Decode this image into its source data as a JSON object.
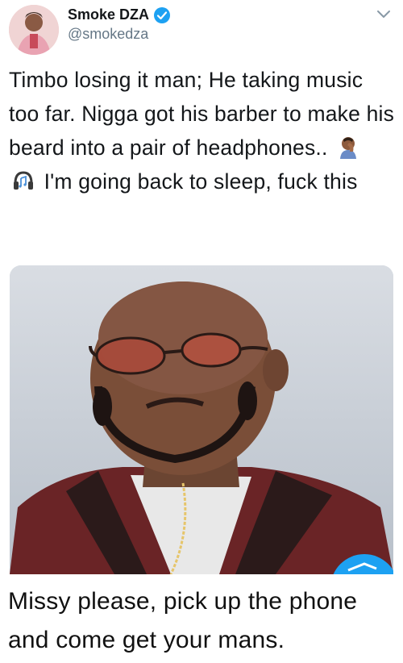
{
  "tweet": {
    "display_name": "Smoke DZA",
    "handle": "@smokedza",
    "verified": true,
    "text_parts": {
      "before_emoji": "Timbo losing it man; He taking music too far. Nigga got his barber to make his beard into a pair of headphones..",
      "after_emoji": " I'm going back to sleep, fuck this"
    },
    "emojis": [
      "facepalm-emoji",
      "headphones-emoji"
    ],
    "media": {
      "description_icon": "photo"
    }
  },
  "caption": "Missy please, pick up the phone and come get your mans.",
  "colors": {
    "verified_blue": "#1da1f2",
    "handle_gray": "#657786",
    "text": "#14171a"
  }
}
